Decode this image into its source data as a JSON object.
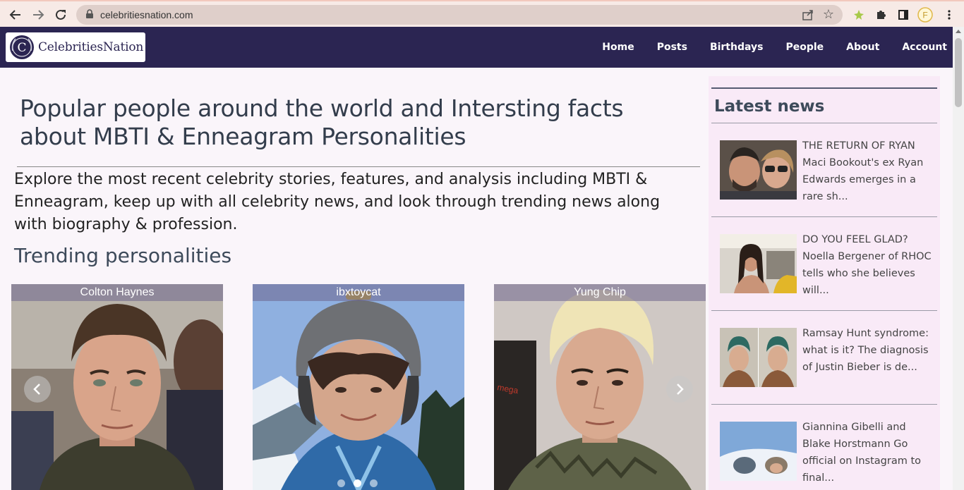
{
  "browser": {
    "url": "celebritiesnation.com",
    "icons": [
      "back-icon",
      "forward-icon",
      "reload-icon",
      "lock-icon",
      "share-icon",
      "star-icon",
      "extension-icon",
      "puzzle-icon",
      "sidepanel-icon",
      "profile-icon",
      "menu-icon"
    ],
    "profile_initial": "F"
  },
  "header": {
    "logo_text": "CelebritiesNation",
    "logo_letter": "C",
    "nav": [
      "Home",
      "Posts",
      "Birthdays",
      "People",
      "About",
      "Account"
    ]
  },
  "main": {
    "headline": "Popular people around the world and Intersting facts about MBTI & Enneagram Personalities",
    "intro": "Explore the most recent celebrity stories, features, and analysis including MBTI & Enneagram, keep up with all celebrity news, and look through trending news along with biography & profession.",
    "trending_title": "Trending personalities",
    "people": [
      {
        "name": "Colton Haynes"
      },
      {
        "name": "ibxtoycat"
      },
      {
        "name": "Yung Chip"
      }
    ],
    "carousel_active_index": 1
  },
  "sidebar": {
    "title": "Latest news",
    "news": [
      {
        "text": "THE RETURN OF RYAN Maci Bookout's ex Ryan Edwards emerges in a rare sh..."
      },
      {
        "text": "DO YOU FEEL GLAD? Noella Bergener of RHOC tells who she believes will..."
      },
      {
        "text": "Ramsay Hunt syndrome: what is it? The diagnosis of Justin Bieber is de..."
      },
      {
        "text": "Giannina Gibelli and Blake Horstmann Go official on Instagram to final..."
      }
    ]
  },
  "colors": {
    "header_bg": "#2b2552",
    "sidebar_bg": "#f9eaf7",
    "page_bg": "#faf5fa",
    "heading": "#333d4c"
  }
}
